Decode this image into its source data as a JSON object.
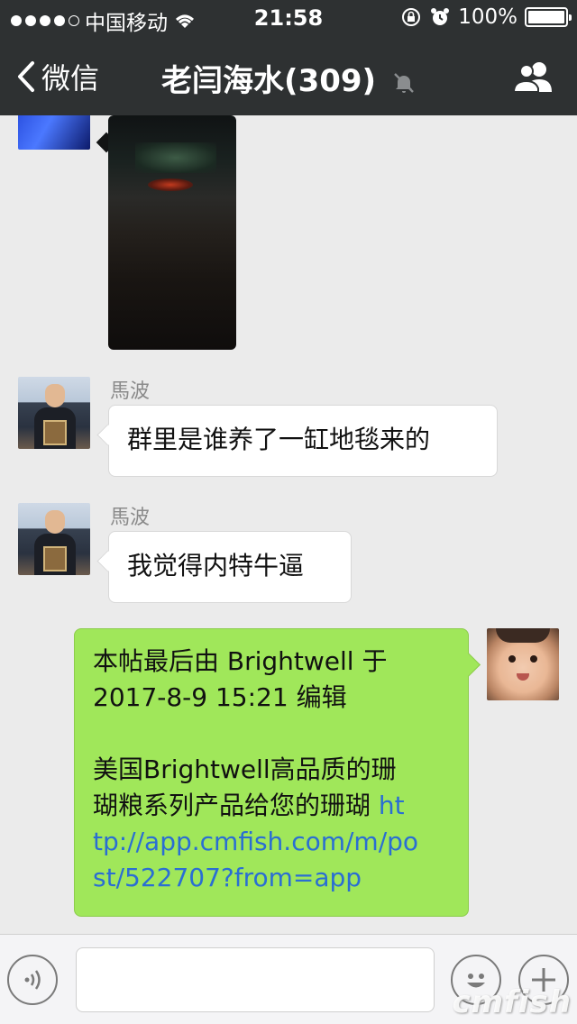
{
  "status": {
    "carrier": "中国移动",
    "time": "21:58",
    "battery": "100%",
    "battery_level": 1.0,
    "signal_bars_filled": 4
  },
  "nav": {
    "back_label": "微信",
    "title": "老闫海水(309)",
    "icons": [
      "chevron-left-icon",
      "mute-bell-icon",
      "group-members-icon"
    ]
  },
  "messages": [
    {
      "type": "image",
      "side": "left"
    },
    {
      "type": "text",
      "side": "left",
      "sender": "馬波",
      "text": "群里是谁养了一缸地毯来的"
    },
    {
      "type": "text",
      "side": "left",
      "sender": "馬波",
      "text": "我觉得内特牛逼"
    },
    {
      "type": "text",
      "side": "right",
      "line1": "本帖最后由 Brightwell 于",
      "line2": "2017-8-9 15:21 编辑",
      "line3": "美国Brightwell高品质的珊",
      "line4_text": "瑚粮系列产品给您的珊瑚 ",
      "link_part1": "ht",
      "link_part2": "tp://app.cmfish.com/m/po",
      "link_part3": "st/522707?from=app"
    }
  ],
  "inputbar": {
    "icons": [
      "voice-icon",
      "emoji-icon",
      "plus-icon"
    ]
  },
  "watermark": "cmfish"
}
